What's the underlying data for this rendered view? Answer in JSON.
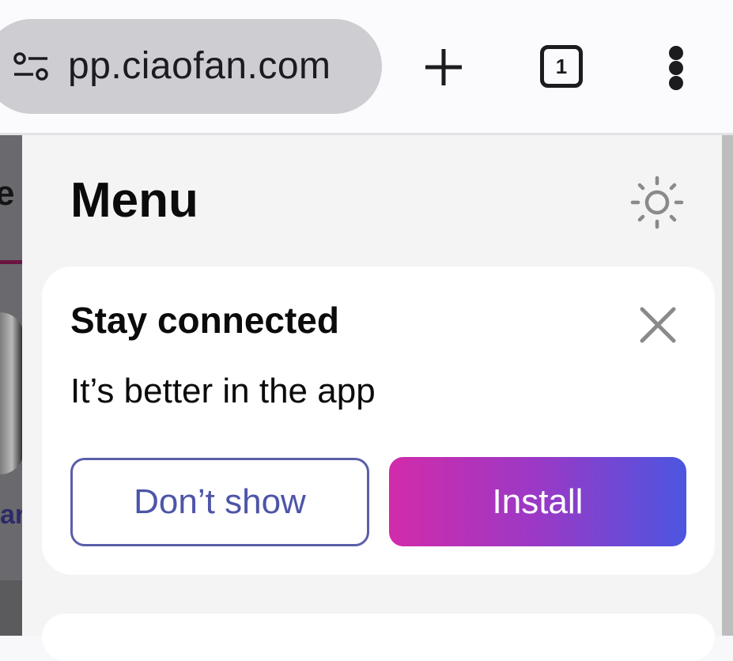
{
  "browser": {
    "url": "app.ciaofan.com",
    "url_visible": "pp.ciaofan.com",
    "tab_count": "1",
    "icons": {
      "site_settings": "tune-icon",
      "new_tab": "plus-icon",
      "tabs": "tab-switcher-icon",
      "menu": "more-vert-icon"
    }
  },
  "background_page": {
    "heading_fragment": "e",
    "label_fragment": "ar"
  },
  "menu": {
    "title": "Menu",
    "theme_icon": "sun-icon"
  },
  "install_card": {
    "title": "Stay connected",
    "subtitle": "It’s better in the app",
    "dont_show_label": "Don’t show",
    "install_label": "Install",
    "close_icon": "close-icon"
  },
  "colors": {
    "accent_outline": "#5a5fa8",
    "install_gradient_start": "#d22baa",
    "install_gradient_end": "#4b56e0",
    "url_pill": "#cecdd1"
  }
}
